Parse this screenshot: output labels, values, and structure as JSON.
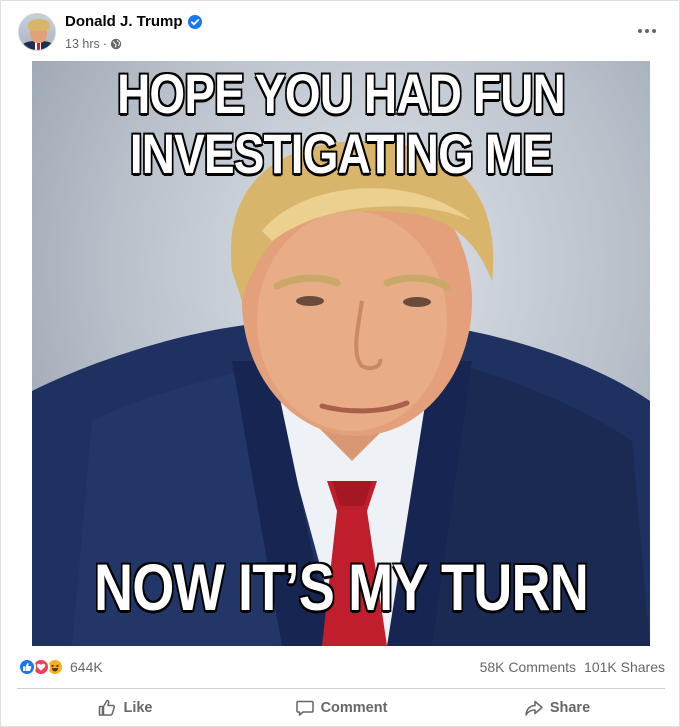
{
  "post": {
    "author": "Donald J. Trump",
    "time": "13 hrs",
    "separator": "·"
  },
  "image": {
    "caption_line1": "HOPE YOU HAD FUN",
    "caption_line2": "INVESTIGATING ME",
    "caption_bottom": "NOW IT’S MY TURN"
  },
  "stats": {
    "reaction_count": "644K",
    "comments": "58K Comments",
    "shares": "101K Shares"
  },
  "actions": {
    "like": "Like",
    "comment": "Comment",
    "share": "Share"
  },
  "icons": {
    "verified": "verified-badge-icon",
    "privacy": "globe-icon",
    "more": "more-options-icon",
    "like": "thumbs-up-icon",
    "comment": "comment-bubble-icon",
    "share": "share-arrow-icon"
  },
  "colors": {
    "verified_blue": "#1877f2",
    "secondary_text": "#65676b",
    "like_reaction": "#1877f2",
    "love_reaction": "#f33e58",
    "haha_reaction": "#f7b125"
  }
}
